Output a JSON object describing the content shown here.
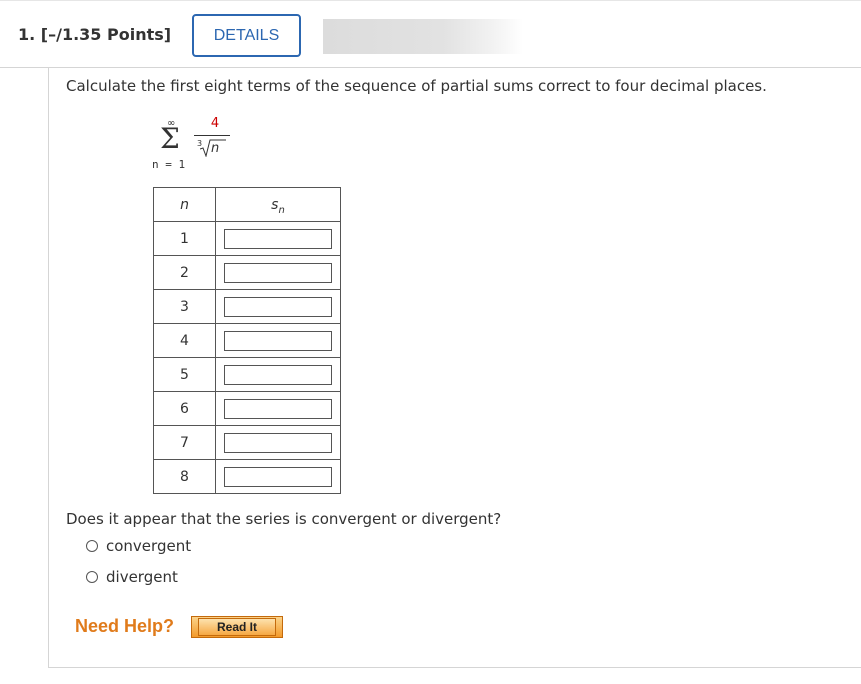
{
  "header": {
    "question_label": "1.  [–/1.35 Points]",
    "details_button": "DETAILS"
  },
  "question": {
    "prompt": "Calculate the first eight terms of the sequence of partial sums correct to four decimal places.",
    "series": {
      "upper_limit": "∞",
      "lower_limit": "n = 1",
      "numerator": "4",
      "root_index": "3",
      "radicand": "n"
    },
    "table": {
      "header_n": "n",
      "header_s": "s",
      "header_s_sub": "n",
      "rows": [
        {
          "n": "1",
          "value": ""
        },
        {
          "n": "2",
          "value": ""
        },
        {
          "n": "3",
          "value": ""
        },
        {
          "n": "4",
          "value": ""
        },
        {
          "n": "5",
          "value": ""
        },
        {
          "n": "6",
          "value": ""
        },
        {
          "n": "7",
          "value": ""
        },
        {
          "n": "8",
          "value": ""
        }
      ]
    },
    "convergence_prompt": "Does it appear that the series is convergent or divergent?",
    "options": [
      "convergent",
      "divergent"
    ]
  },
  "help": {
    "need_help_label": "Need Help?",
    "read_it_button": "Read It"
  },
  "colors": {
    "accent": "#2c67b1",
    "numerator": "#cc0000",
    "need_help": "#e07b1b",
    "read_button": "#f39a2b"
  }
}
